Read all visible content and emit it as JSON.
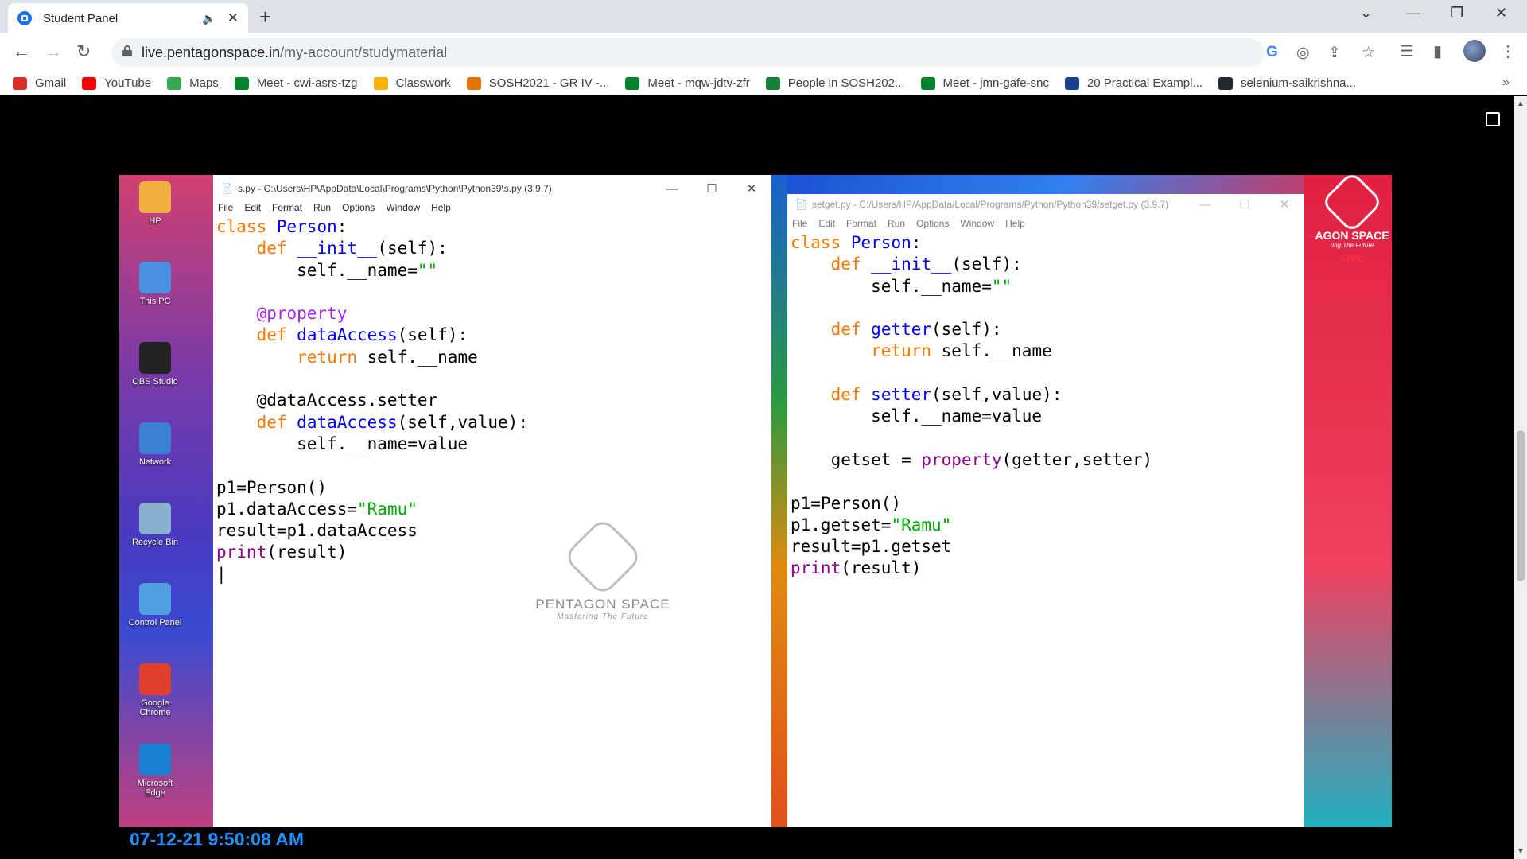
{
  "tab": {
    "title": "Student Panel"
  },
  "toolbar": {
    "url_host": "live.pentagonspace.in",
    "url_path": "/my-account/studymaterial"
  },
  "bookmarks": [
    {
      "label": "Gmail",
      "icon": "gmail-icon",
      "color": "#d93025"
    },
    {
      "label": "YouTube",
      "icon": "youtube-icon",
      "color": "#ff0000"
    },
    {
      "label": "Maps",
      "icon": "maps-icon",
      "color": "#34a853"
    },
    {
      "label": "Meet - cwi-asrs-tzg",
      "icon": "meet-icon",
      "color": "#00832d"
    },
    {
      "label": "Classwork",
      "icon": "classroom-icon",
      "color": "#f4b400"
    },
    {
      "label": "SOSH2021 - GR IV -...",
      "icon": "classroom-icon",
      "color": "#e37400"
    },
    {
      "label": "Meet - mqw-jdtv-zfr",
      "icon": "meet-icon",
      "color": "#00832d"
    },
    {
      "label": "People in SOSH202...",
      "icon": "classroom-icon",
      "color": "#188038"
    },
    {
      "label": "Meet - jmn-gafe-snc",
      "icon": "meet-icon",
      "color": "#00832d"
    },
    {
      "label": "20 Practical Exampl...",
      "icon": "site-icon",
      "color": "#1a3f8f"
    },
    {
      "label": "selenium-saikrishna...",
      "icon": "github-icon",
      "color": "#24292f"
    }
  ],
  "desktop_icons": [
    {
      "label": "HP"
    },
    {
      "label": "This PC"
    },
    {
      "label": "OBS Studio"
    },
    {
      "label": "Network"
    },
    {
      "label": "Recycle Bin"
    },
    {
      "label": "Control Panel"
    },
    {
      "label": "Google Chrome"
    },
    {
      "label": "Microsoft Edge"
    }
  ],
  "left_window": {
    "title": "s.py - C:\\Users\\HP\\AppData\\Local\\Programs\\Python\\Python39\\s.py (3.9.7)",
    "menu": [
      "File",
      "Edit",
      "Format",
      "Run",
      "Options",
      "Window",
      "Help"
    ]
  },
  "right_window": {
    "title": "setget.py - C:/Users/HP/AppData/Local/Programs/Python/Python39/setget.py (3.9.7)",
    "menu": [
      "File",
      "Edit",
      "Format",
      "Run",
      "Options",
      "Window",
      "Help"
    ]
  },
  "watermark": {
    "name": "PENTAGON SPACE",
    "tagline": "Mastering The Future"
  },
  "brand": {
    "name": "AGON SPACE",
    "tagline": "ring The Future",
    "live": "LIVE"
  },
  "timestamp": "07-12-21 9:50:08 AM"
}
